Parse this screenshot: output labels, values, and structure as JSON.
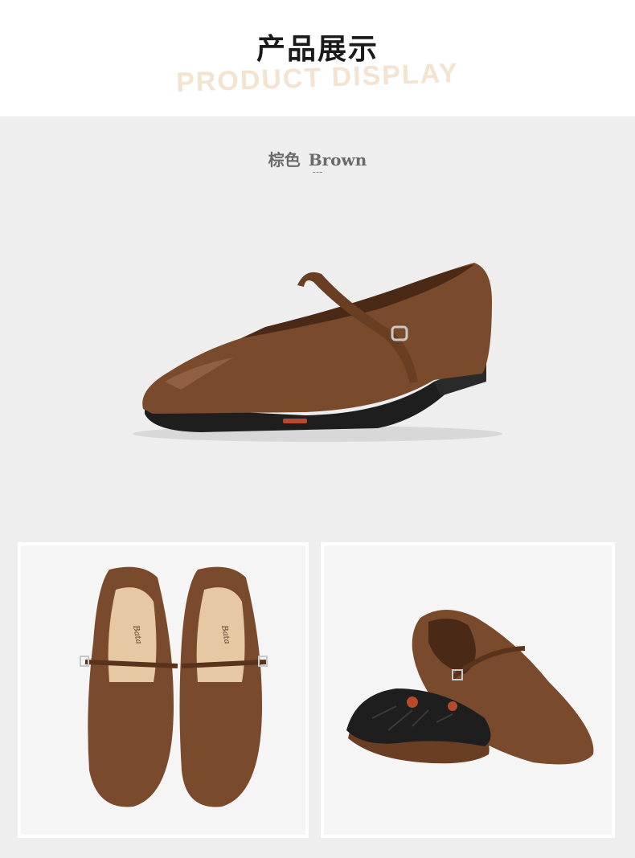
{
  "header": {
    "title": "产品展示",
    "subtitle": "PRODUCT DISPLAY"
  },
  "hero": {
    "color_zh": "棕色",
    "color_en": "Brown",
    "divider": "---",
    "image": "brown-mary-jane-flat-side-view"
  },
  "gallery": {
    "left_image": "brown-mary-jane-flats-top-view",
    "right_image": "brown-mary-jane-flats-sole-and-angle-view",
    "insole_brand": "Bata"
  },
  "colors": {
    "leather": "#7a4a2c",
    "leather_dark": "#5a331d",
    "insole": "#e6c9a3",
    "sole": "#1e1e1e",
    "accent_red": "#b84a2a"
  }
}
